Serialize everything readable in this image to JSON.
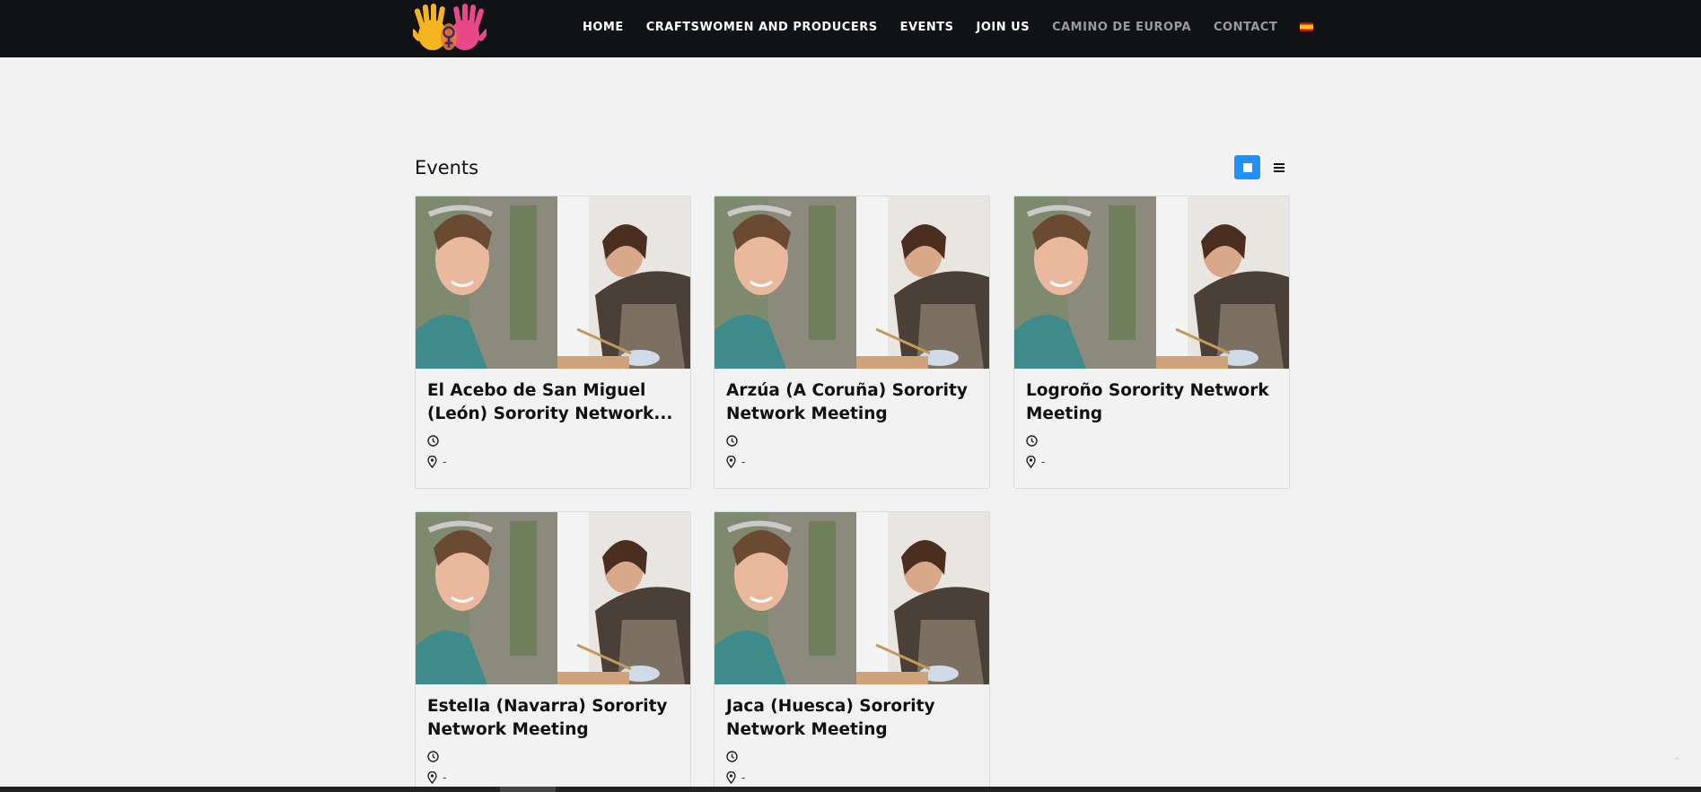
{
  "brand": {
    "logo_name": "hands-logo",
    "colors": {
      "yellow": "#f5b51e",
      "orange": "#f07a3a",
      "pink": "#e8488a",
      "symbol": "#3a2a6a"
    }
  },
  "nav": {
    "items": [
      {
        "label": "HOME",
        "muted": false
      },
      {
        "label": "CRAFTSWOMEN AND PRODUCERS",
        "muted": false
      },
      {
        "label": "EVENTS",
        "muted": false
      },
      {
        "label": "JOIN US",
        "muted": false
      },
      {
        "label": "CAMINO DE EUROPA",
        "muted": true
      },
      {
        "label": "CONTACT",
        "muted": true
      }
    ],
    "language_icon": "spain-flag-icon"
  },
  "page": {
    "title": "Events"
  },
  "view_toggle": {
    "grid_icon": "grid-view-icon",
    "list_icon": "list-view-icon",
    "active": "grid",
    "accent": "#1e90ff"
  },
  "events": [
    {
      "title": "El Acebo de San Miguel (León) Sorority Network...",
      "time": "",
      "location": "-"
    },
    {
      "title": "Arzúa (A Coruña) Sorority Network Meeting",
      "time": "",
      "location": "-"
    },
    {
      "title": "Logroño Sorority Network Meeting",
      "time": "",
      "location": "-"
    },
    {
      "title": "Estella (Navarra) Sorority Network Meeting",
      "time": "",
      "location": "-"
    },
    {
      "title": "Jaca (Huesca) Sorority Network Meeting",
      "time": "",
      "location": "-"
    }
  ]
}
